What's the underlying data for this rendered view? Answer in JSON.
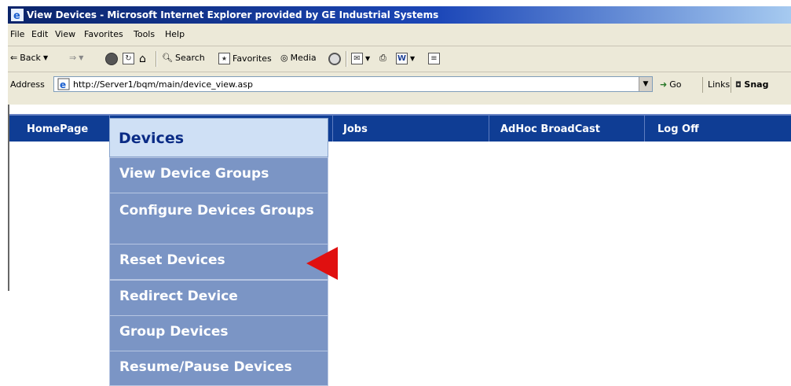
{
  "window": {
    "title": "View Devices - Microsoft Internet Explorer provided by GE Industrial Systems"
  },
  "menubar": [
    "File",
    "Edit",
    "View",
    "Favorites",
    "Tools",
    "Help"
  ],
  "toolbar": {
    "back": "Back",
    "search": "Search",
    "favorites": "Favorites",
    "media": "Media",
    "word_icon": "W"
  },
  "addressbar": {
    "label": "Address",
    "url": "http://Server1/bqm/main/device_view.asp",
    "go": "Go",
    "links": "Links",
    "snagit": "Snag"
  },
  "nav": {
    "items": [
      "HomePage",
      "Devices",
      "Jobs",
      "AdHoc BroadCast",
      "Log Off"
    ],
    "bg_color": "#0f3d94"
  },
  "dropdown": {
    "header": "Devices",
    "items": [
      "View Device Groups",
      "Configure Devices Groups",
      "Reset Devices",
      "Redirect Device",
      "Group Devices",
      "Resume/Pause Devices"
    ],
    "highlight": "Reset Devices",
    "arrow_color": "#e01010"
  }
}
